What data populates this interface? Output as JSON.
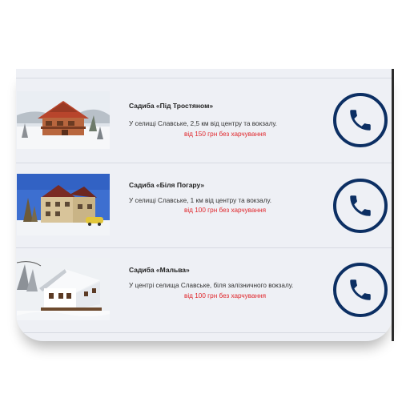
{
  "listings": [
    {
      "title": "Садиба «Під Тростяном»",
      "description": "У селищі Славське, 2,5 км від центру та вокзалу.",
      "price": "від 150 грн без харчування",
      "image_icon": "winter-chalet-photo",
      "call_icon": "phone-icon"
    },
    {
      "title": "Садиба «Біля Погару»",
      "description": "У селищі Славське, 1 км від центру та вокзалу.",
      "price": "від 100 грн без харчування",
      "image_icon": "guesthouse-photo",
      "call_icon": "phone-icon"
    },
    {
      "title": "Садиба «Мальва»",
      "description": "У центрі селища Славське, біля залізничного вокзалу.",
      "price": "від 100 грн без харчування",
      "image_icon": "snowy-house-photo",
      "call_icon": "phone-icon"
    }
  ],
  "colors": {
    "accent": "#0c2f63",
    "price": "#e0262b",
    "card_background": "#eef0f5"
  }
}
